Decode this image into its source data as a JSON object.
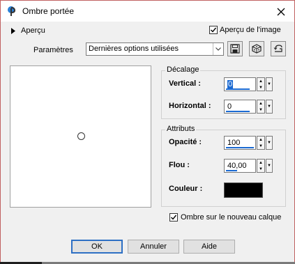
{
  "window": {
    "title": "Ombre portée"
  },
  "preview_toggle": {
    "label": "Aperçu"
  },
  "preview_on_image": {
    "label": "Aperçu de l'image",
    "checked": true
  },
  "params": {
    "label": "Paramètres",
    "selected": "Dernières options utilisées"
  },
  "offset": {
    "title": "Décalage",
    "vertical_label": "Vertical :",
    "vertical_value": "0",
    "horizontal_label": "Horizontal :",
    "horizontal_value": "0"
  },
  "attributes": {
    "title": "Attributs",
    "opacity_label": "Opacité :",
    "opacity_value": "100",
    "blur_label": "Flou :",
    "blur_value": "40,00",
    "color_label": "Couleur :",
    "color_value": "#000000"
  },
  "new_layer": {
    "label": "Ombre sur le nouveau calque",
    "checked": true
  },
  "buttons": {
    "ok": "OK",
    "cancel": "Annuler",
    "help": "Aide"
  },
  "colors": {
    "accent": "#1b6ad2",
    "dialog_bg": "#f0f0f0",
    "frame": "#c06060"
  }
}
